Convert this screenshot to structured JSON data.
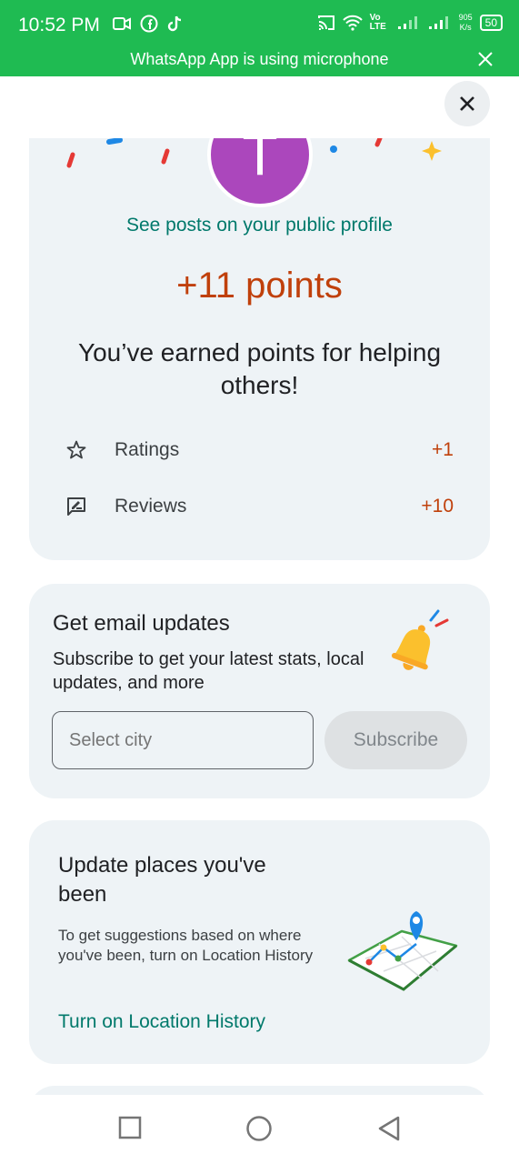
{
  "status_bar": {
    "time": "10:52 PM",
    "net_speed_value": "905",
    "net_speed_unit": "K/s",
    "network_label": "Vo LTE",
    "battery": "50",
    "banner_text": "WhatsApp App is using microphone",
    "colors": {
      "background": "#1fbb52",
      "text": "#ffffff"
    }
  },
  "dialog": {
    "close_icon": "close-icon"
  },
  "points_card": {
    "avatar_letter": "T",
    "avatar_color": "#ab47bc",
    "see_posts": "See posts on your public profile",
    "points_text": "+11 points",
    "earned_text": "You’ve earned points for helping others!",
    "rows": [
      {
        "icon": "star-outline-icon",
        "label": "Ratings",
        "value": "+1"
      },
      {
        "icon": "review-icon",
        "label": "Reviews",
        "value": "+10"
      }
    ],
    "accent_color": "#c0400b"
  },
  "email_card": {
    "title": "Get email updates",
    "description": "Subscribe to get your latest stats, local updates, and more",
    "city_placeholder": "Select city",
    "subscribe_label": "Subscribe",
    "icon": "bell-icon"
  },
  "places_card": {
    "title": "Update places you've been",
    "description": "To get suggestions based on where you've been, turn on Location History",
    "link_label": "Turn on Location History",
    "icon": "map-pin-icon",
    "link_color": "#00796b"
  },
  "nav_bar": {
    "items": [
      "recents-square-icon",
      "home-circle-icon",
      "back-triangle-icon"
    ]
  }
}
